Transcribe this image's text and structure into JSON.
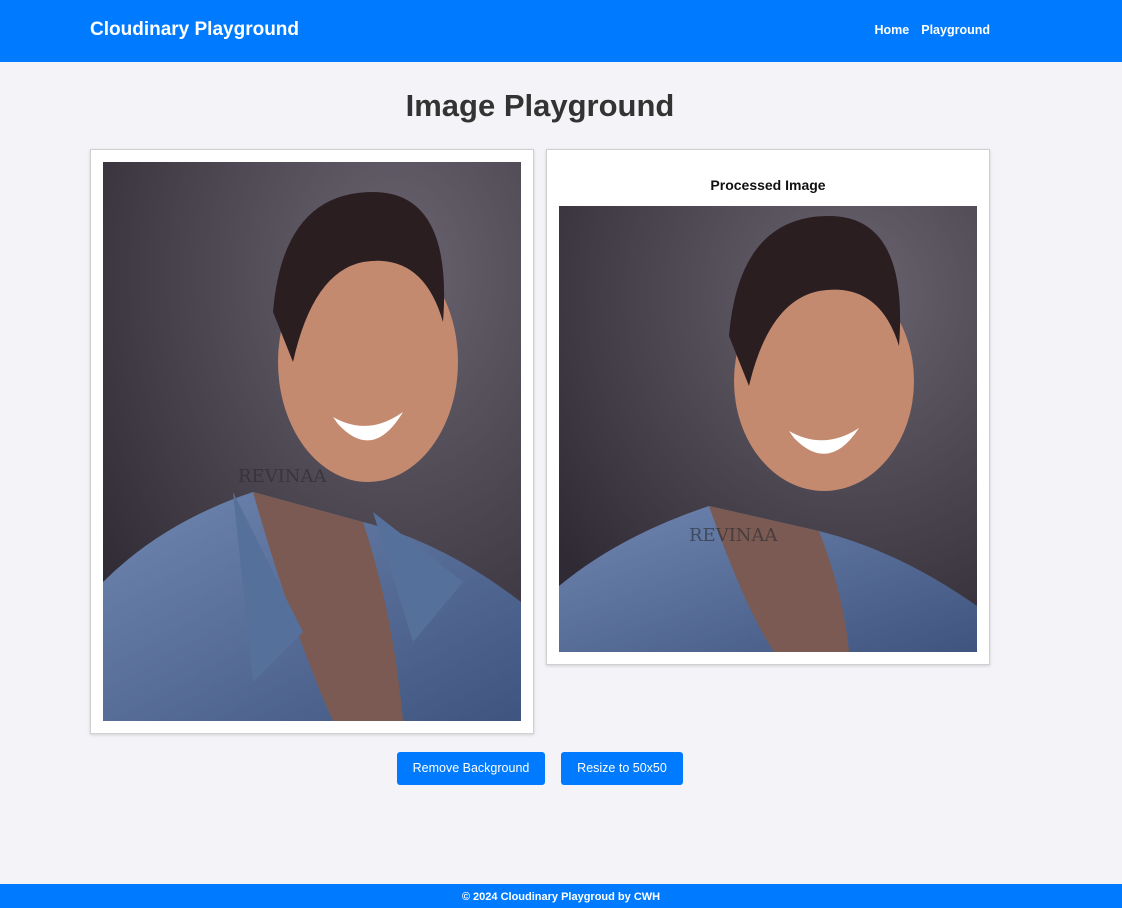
{
  "navbar": {
    "brand": "Cloudinary Playground",
    "links": [
      "Home",
      "Playground"
    ]
  },
  "main": {
    "title": "Image Playground",
    "original_image": {
      "watermark": "REVINAA"
    },
    "processed_card": {
      "title": "Processed Image",
      "watermark": "REVINAA"
    },
    "buttons": {
      "remove_background": "Remove Background",
      "resize": "Resize to 50x50"
    }
  },
  "footer": {
    "text": "© 2024 Cloudinary Playgroud by CWH"
  },
  "colors": {
    "primary": "#007bff",
    "background": "#f4f4f8",
    "card_border": "#d0d0d0"
  }
}
